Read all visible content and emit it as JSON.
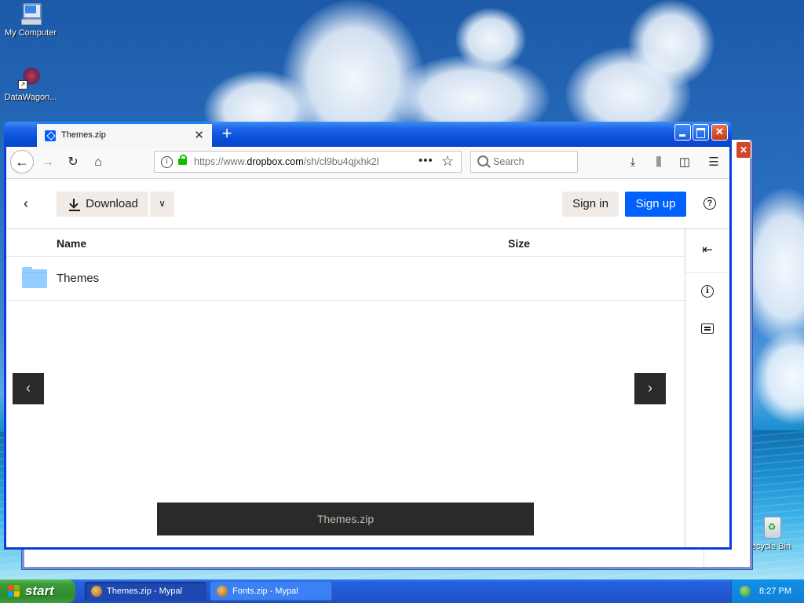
{
  "desktop": {
    "icons": [
      {
        "label": "My Computer"
      },
      {
        "label": "DataWagon..."
      },
      {
        "label": "ecycle Bin"
      }
    ]
  },
  "browser": {
    "tab_title": "Themes.zip",
    "new_tab_symbol": "+",
    "url_prefix": "https://www.",
    "url_domain": "dropbox.com",
    "url_path": "/sh/cl9bu4qjxhk2l",
    "search_placeholder": "Search",
    "window_controls": {
      "minimize": "_",
      "maximize": "□",
      "close": "✕"
    }
  },
  "dropbox": {
    "download_label": "Download",
    "sign_in_label": "Sign in",
    "sign_up_label": "Sign up",
    "help_symbol": "?",
    "columns": {
      "name": "Name",
      "size": "Size"
    },
    "files": [
      {
        "name": "Themes",
        "size": "",
        "icon": "folder-icon"
      }
    ],
    "preview_filename": "Themes.zip"
  },
  "taskbar": {
    "start_label": "start",
    "items": [
      {
        "label": "Themes.zip - Mypal",
        "active": true
      },
      {
        "label": "Fonts.zip - Mypal",
        "active": false
      }
    ],
    "clock": "8:27 PM"
  },
  "colors": {
    "dropbox_blue": "#0061fe",
    "xp_title_blue": "#0a4cd8",
    "button_beige": "#f0ebe6",
    "start_green": "#3a9b38"
  }
}
